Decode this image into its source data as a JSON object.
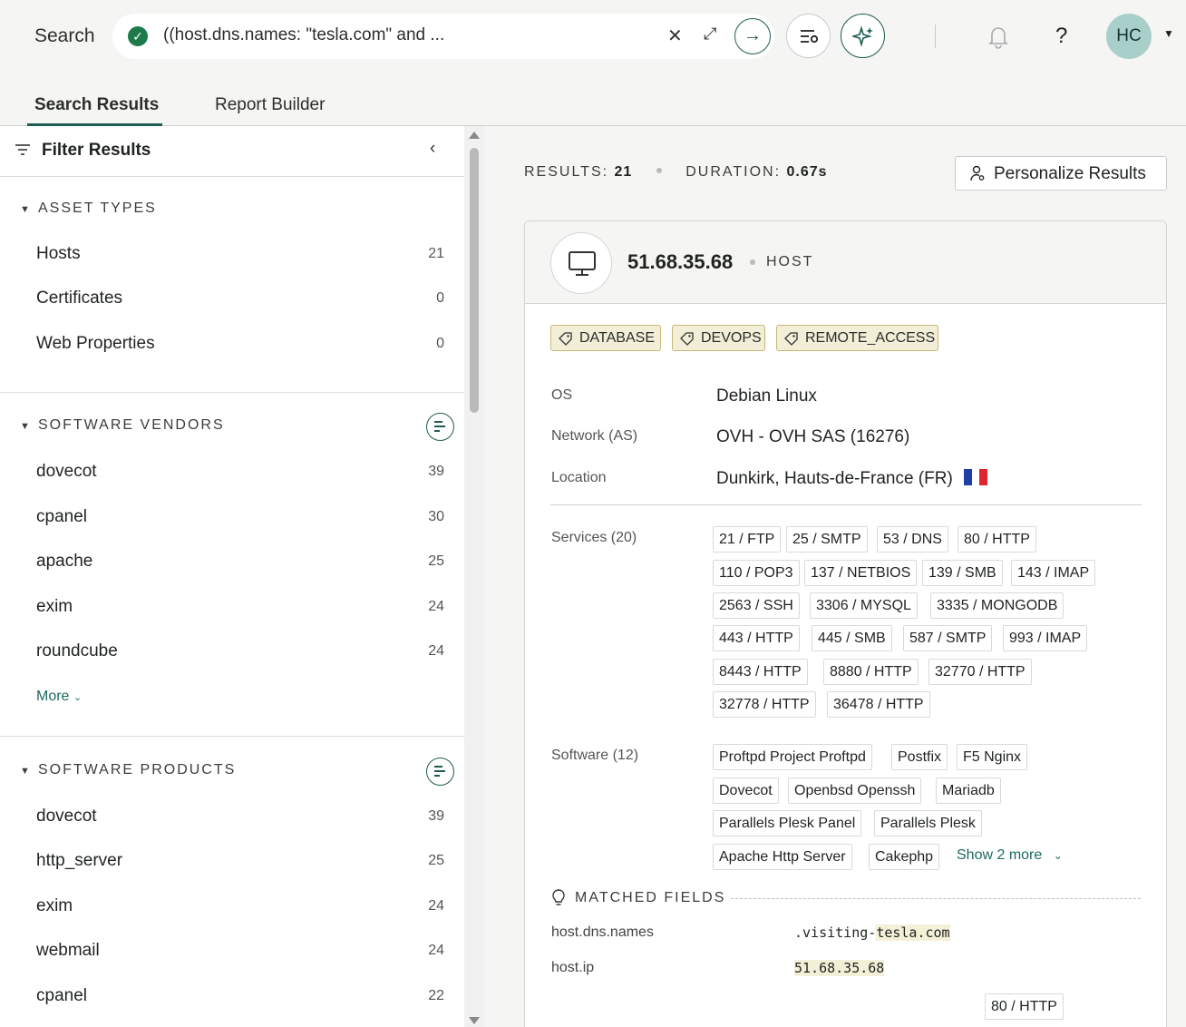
{
  "header": {
    "search_label": "Search",
    "query": "((host.dns.names: \"tesla.com\" and ...",
    "avatar_initials": "HC"
  },
  "tabs": [
    {
      "label": "Search Results",
      "active": true
    },
    {
      "label": "Report Builder",
      "active": false
    }
  ],
  "sidebar": {
    "title": "Filter Results",
    "asset_types": {
      "title": "ASSET TYPES",
      "items": [
        {
          "label": "Hosts",
          "count": "21"
        },
        {
          "label": "Certificates",
          "count": "0"
        },
        {
          "label": "Web Properties",
          "count": "0"
        }
      ]
    },
    "software_vendors": {
      "title": "SOFTWARE VENDORS",
      "items": [
        {
          "label": "dovecot",
          "count": "39"
        },
        {
          "label": "cpanel",
          "count": "30"
        },
        {
          "label": "apache",
          "count": "25"
        },
        {
          "label": "exim",
          "count": "24"
        },
        {
          "label": "roundcube",
          "count": "24"
        }
      ],
      "more_label": "More"
    },
    "software_products": {
      "title": "SOFTWARE PRODUCTS",
      "items": [
        {
          "label": "dovecot",
          "count": "39"
        },
        {
          "label": "http_server",
          "count": "25"
        },
        {
          "label": "exim",
          "count": "24"
        },
        {
          "label": "webmail",
          "count": "24"
        },
        {
          "label": "cpanel",
          "count": "22"
        }
      ]
    }
  },
  "summary": {
    "results_label": "RESULTS:",
    "results_value": "21",
    "duration_label": "DURATION:",
    "duration_value": "0.67s",
    "personalize_label": "Personalize Results"
  },
  "result": {
    "ip": "51.68.35.68",
    "type": "HOST",
    "tags": [
      "DATABASE",
      "DEVOPS",
      "REMOTE_ACCESS"
    ],
    "fields": [
      {
        "label": "OS",
        "value": "Debian Linux"
      },
      {
        "label": "Network (AS)",
        "value": "OVH - OVH SAS (16276)"
      },
      {
        "label": "Location",
        "value": "Dunkirk, Hauts-de-France (FR)"
      }
    ],
    "services_label": "Services (20)",
    "services": [
      "21 / FTP",
      "25 / SMTP",
      "53 / DNS",
      "80 / HTTP",
      "110 / POP3",
      "137 / NETBIOS",
      "139 / SMB",
      "143 / IMAP",
      "2563 / SSH",
      "3306 / MYSQL",
      "3335 / MONGODB",
      "443 / HTTP",
      "445 / SMB",
      "587 / SMTP",
      "993 / IMAP",
      "8443 / HTTP",
      "8880 / HTTP",
      "32770 / HTTP",
      "32778 / HTTP",
      "36478 / HTTP"
    ],
    "software_label": "Software (12)",
    "software": [
      "Proftpd Project Proftpd",
      "Postfix",
      "F5 Nginx",
      "Dovecot",
      "Openbsd Openssh",
      "Mariadb",
      "Parallels Plesk Panel",
      "Parallels Plesk",
      "Apache Http Server",
      "Cakephp"
    ],
    "show_more_label": "Show 2 more",
    "matched_fields_label": "MATCHED FIELDS",
    "matched_fields": [
      {
        "key": "host.dns.names",
        "value_prefix": ".visiting-",
        "value_highlight": "tesla.com"
      },
      {
        "key": "host.ip",
        "value_prefix": "",
        "value_highlight": "51.68.35.68"
      }
    ],
    "matched_service_chip": "80 / HTTP"
  },
  "colors": {
    "accent": "#1e5c52",
    "tag_bg": "#f2eed7",
    "tag_border": "#c5b97a",
    "highlight": "#f4f0d8"
  }
}
